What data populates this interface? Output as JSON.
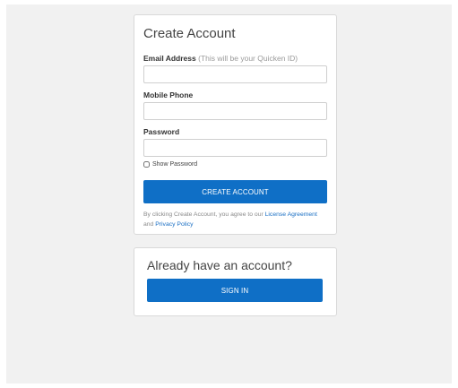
{
  "create_account": {
    "title": "Create Account",
    "email_label": "Email Address",
    "email_hint": "(This will be your Quicken ID)",
    "email_value": "",
    "mobile_label": "Mobile Phone",
    "mobile_value": "",
    "password_label": "Password",
    "password_value": "",
    "show_password_label": "Show Password",
    "show_password_checked": false,
    "button_label": "CREATE ACCOUNT",
    "terms_prefix": "By clicking Create Account, you agree to our ",
    "license_link": "License Agreement",
    "terms_and": " and ",
    "privacy_link": "Privacy Policy"
  },
  "sign_in": {
    "title": "Already have an account?",
    "button_label": "SIGN IN"
  },
  "colors": {
    "primary_button": "#0f6fc6",
    "link": "#1a6fc4",
    "page_background": "#f1f1f1"
  }
}
